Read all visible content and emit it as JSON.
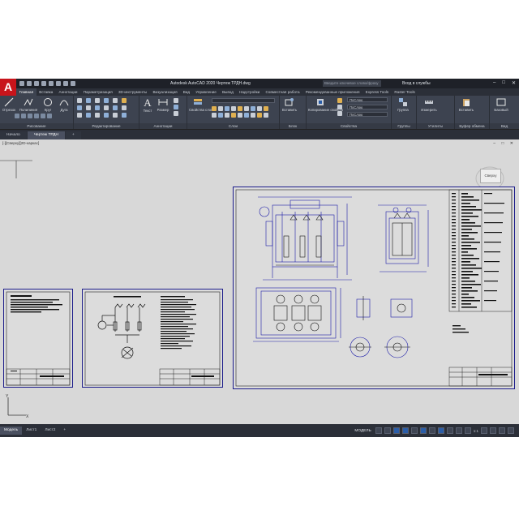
{
  "titlebar": {
    "title": "Autodesk AutoCAD 2020  Чертеж ТРДН.dwg",
    "search_placeholder": "Введите ключевое слово/фразу",
    "signin": "Вход в службы"
  },
  "ribbon_tabs": [
    "Главная",
    "Вставка",
    "Аннотации",
    "Параметризация",
    "3D-инструменты",
    "Визуализация",
    "Вид",
    "Управление",
    "Вывод",
    "Надстройки",
    "Совместная работа",
    "Рекомендованные приложения",
    "Express Tools",
    "Raster Tools"
  ],
  "panels": {
    "draw": {
      "title": "Рисование",
      "tools": [
        "Отрезок",
        "Полилиния",
        "Круг",
        "Дуга"
      ]
    },
    "modify": {
      "title": "Редактирование"
    },
    "annotation": {
      "title": "Аннотации",
      "tools": [
        "Текст",
        "Размер"
      ]
    },
    "layers": {
      "title": "Слои",
      "tools": [
        "Свойства слоя"
      ]
    },
    "block": {
      "title": "Блок",
      "tools": [
        "Вставить"
      ]
    },
    "properties": {
      "title": "Свойства",
      "tools": [
        "Копирование свойств"
      ],
      "fields": [
        "ПоСлою",
        "ПоСлою",
        "ПоСлою"
      ]
    },
    "groups": {
      "title": "Группы",
      "tools": [
        "Группа"
      ]
    },
    "utilities": {
      "title": "Утилиты",
      "tools": [
        "Измерить"
      ]
    },
    "clipboard": {
      "title": "Буфер обмена",
      "tools": [
        "Вставить"
      ]
    },
    "view": {
      "title": "Вид",
      "tools": [
        "Базовый"
      ]
    }
  },
  "file_tabs": [
    {
      "label": "Начало",
      "active": false
    },
    {
      "label": "Чертеж ТРДН",
      "active": true
    }
  ],
  "viewport_label": "[-][Сверху][2D-каркас]",
  "viewcube_label": "Сверху",
  "layout_tabs": [
    {
      "label": "Модель",
      "active": true
    },
    {
      "label": "Лист1",
      "active": false
    },
    {
      "label": "Лист2",
      "active": false
    }
  ],
  "status": {
    "model": "МОДЕЛЬ",
    "scale": "1:1"
  }
}
